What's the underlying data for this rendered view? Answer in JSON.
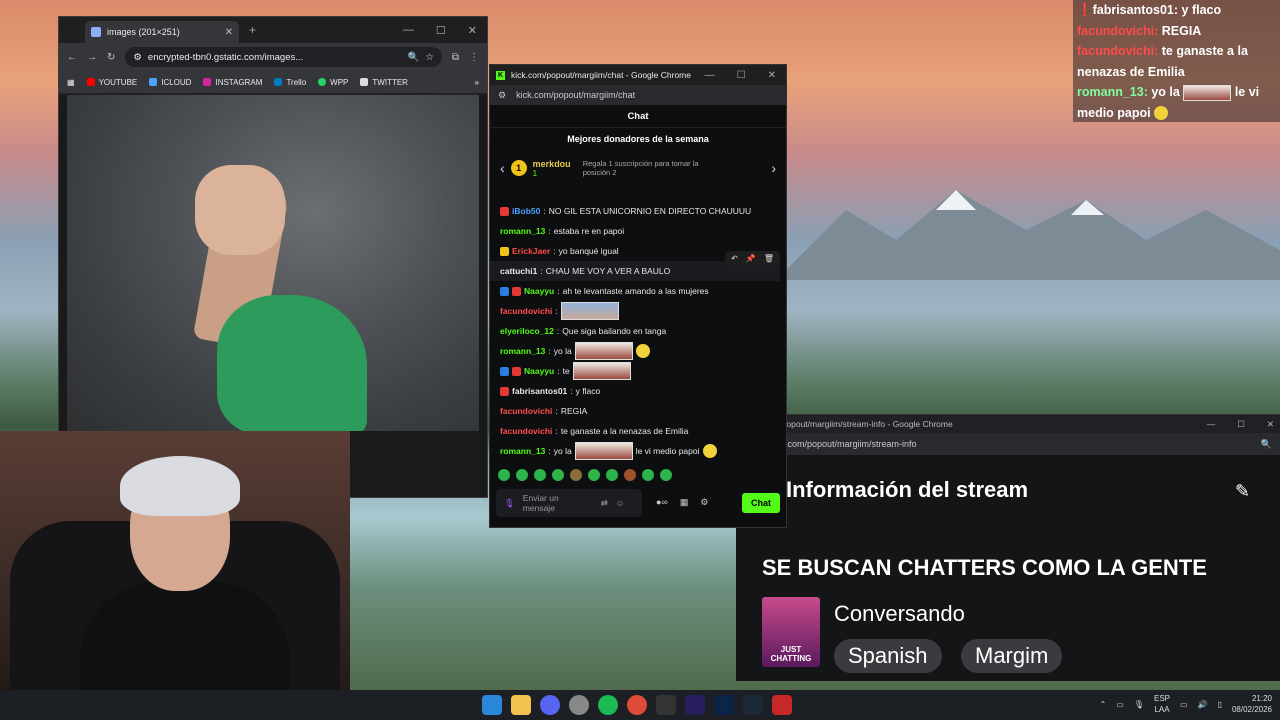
{
  "left_browser": {
    "tab_title": "images (201×251)",
    "url": "encrypted-tbn0.gstatic.com/images...",
    "bookmarks": [
      "YOUTUBE",
      "ICLOUD",
      "INSTAGRAM",
      "Trello",
      "WPP",
      "TWITTER"
    ]
  },
  "chat_window": {
    "title": "kick.com/popout/margiim/chat - Google Chrome",
    "url": "kick.com/popout/margiim/chat",
    "header": "Chat",
    "donors_title": "Mejores donadores de la semana",
    "donor_rank": "1",
    "donor_name": "merkdou",
    "donor_subs": "1",
    "donor_cta": "Regala 1 suscripción para tomar la posición 2",
    "messages": [
      {
        "user": "iBob50",
        "color": "#4aa3ff",
        "text": "NO GIL ESTA UNICORNIO EN DIRECTO CHAUUUU"
      },
      {
        "user": "romann_13",
        "color": "#53fc18",
        "text": "estaba re en papoi"
      },
      {
        "user": "ErickJaer",
        "color": "#ff4b4b",
        "text": "yo banqué igual"
      },
      {
        "user": "cattuchi1",
        "color": "#e8e8e8",
        "text": "CHAU ME VOY A VER A BAULO"
      },
      {
        "user": "Naayyu",
        "color": "#53fc18",
        "text": "ah te levantaste amando a las mujeres"
      },
      {
        "user": "facundovichi",
        "color": "#ff4b4b",
        "text": ""
      },
      {
        "user": "elyeriloco_12",
        "color": "#53fc18",
        "text": "Que siga bailando en tanga"
      },
      {
        "user": "romann_13",
        "color": "#53fc18",
        "text": "yo la"
      },
      {
        "user": "Naayyu",
        "color": "#53fc18",
        "text": "te"
      },
      {
        "user": "fabrisantos01",
        "color": "#e8e8e8",
        "text": "y flaco"
      },
      {
        "user": "facundovichi",
        "color": "#ff4b4b",
        "text": "REGIA"
      },
      {
        "user": "facundovichi",
        "color": "#ff4b4b",
        "text": "te ganaste a la nenazas de Emilia"
      },
      {
        "user": "romann_13",
        "color": "#53fc18",
        "text": "yo la"
      }
    ],
    "last_msg_tail": "le vi medio papoi",
    "input_placeholder": "Enviar un mensaje",
    "send_label": "Chat"
  },
  "overlay_chat": [
    {
      "user": "fabrisantos01:",
      "color": "#ffffff",
      "text": "y flaco"
    },
    {
      "user": "facundovichi:",
      "color": "#ff4b4b",
      "text": "REGIA"
    },
    {
      "user": "facundovichi:",
      "color": "#ff4b4b",
      "text": "te ganaste a la"
    },
    {
      "user": "",
      "color": "#ffffff",
      "text": "nenazas de Emilia"
    },
    {
      "user": "romann_13:",
      "color": "#7fffa0",
      "text": "yo la"
    },
    {
      "user": "",
      "color": "#ffffff",
      "text": "medio papoi"
    }
  ],
  "overlay_tail": "le vi",
  "stream_info": {
    "window_title": "l.kick.com/popout/margiim/stream-info - Google Chrome",
    "url": "board.kick.com/popout/margiim/stream-info",
    "heading": "Información del stream",
    "stream_title": "SE BUSCAN CHATTERS COMO LA GENTE",
    "category": "Conversando",
    "category_image_label": "JUST CHATTING",
    "tags": [
      "Spanish",
      "Margim"
    ]
  },
  "taskbar": {
    "lang_top": "ESP",
    "lang_bottom": "LAA",
    "time": "21:20",
    "date": "08/02/2026"
  }
}
